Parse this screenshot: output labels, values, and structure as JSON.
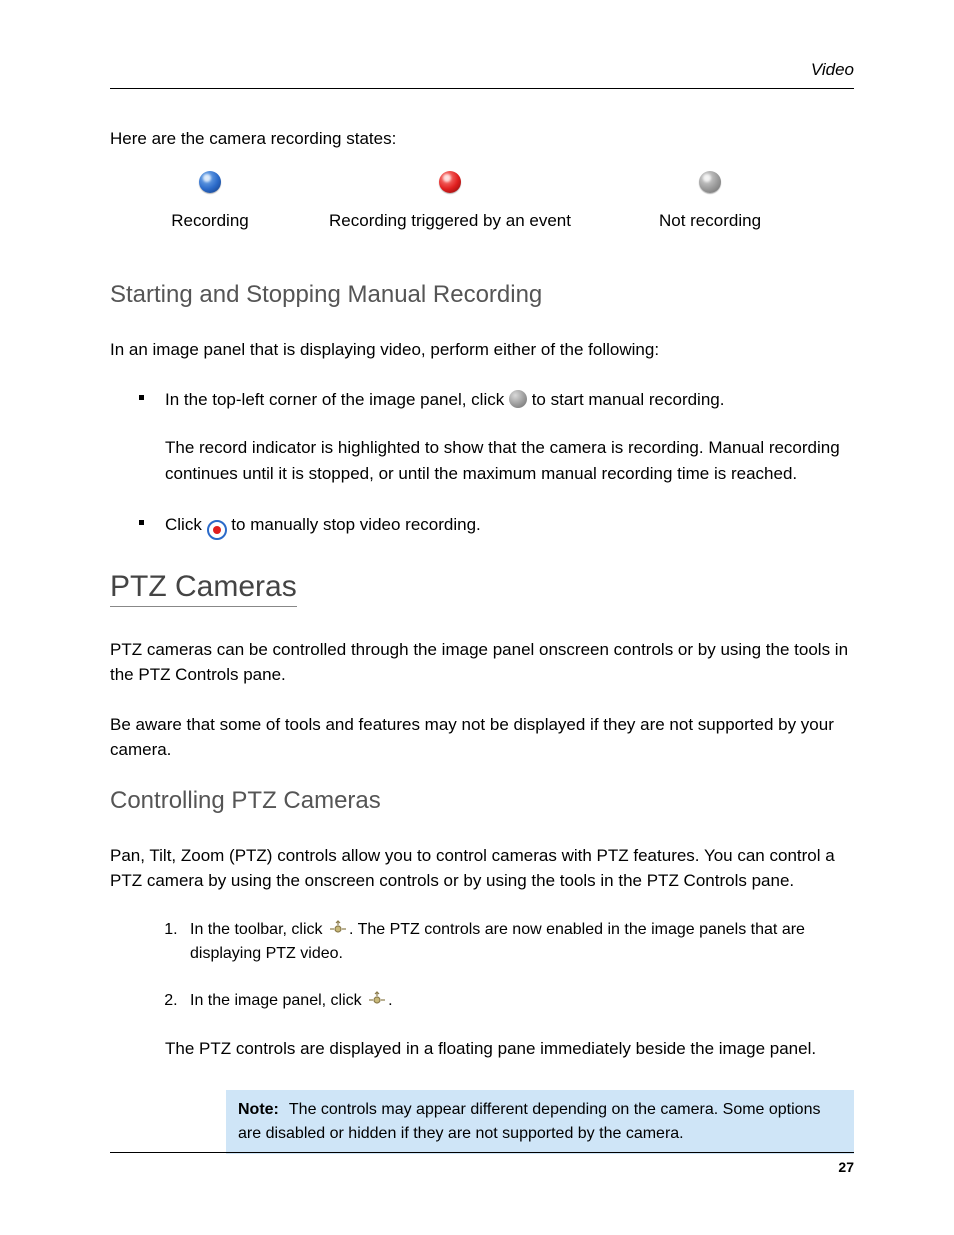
{
  "header": {
    "section_label": "Video"
  },
  "intro": "Here are the camera recording states:",
  "states": [
    {
      "label": "Recording"
    },
    {
      "label": "Recording triggered by an event"
    },
    {
      "label": "Not recording"
    }
  ],
  "subhead1": "Starting and Stopping Manual Recording",
  "para1": "In an image panel that is displaying video, perform either of the following:",
  "bullets": {
    "b1_pre": "In the top-left corner of the image panel, click ",
    "b1_post": " to start manual recording.",
    "b1_follow": "The record indicator is highlighted to show that the camera is recording. Manual recording continues until it is stopped, or until the maximum manual recording time is reached.",
    "b2_pre": "Click ",
    "b2_post": " to manually stop video recording."
  },
  "section2": "PTZ Cameras",
  "para2": "PTZ cameras can be controlled through the image panel onscreen controls or by using the tools in the PTZ Controls pane.",
  "para3": "Be aware that some of tools and features may not be displayed if they are not supported by your camera.",
  "subhead2": "Controlling PTZ Cameras",
  "para4": "Pan, Tilt, Zoom (PTZ) controls allow you to control cameras with PTZ features. You can control a PTZ camera by using the onscreen controls or by using the tools in the PTZ Controls pane.",
  "steps": {
    "s1_pre": "In the toolbar, click ",
    "s1_post": ". The PTZ controls are now enabled in the image panels that are displaying PTZ video.",
    "s2_pre": "In the image panel, click ",
    "s2_post": "."
  },
  "step_follow": "The PTZ controls are displayed in a floating pane immediately beside the image panel.",
  "note": {
    "label": "Note:",
    "text": "The controls may appear different depending on the camera. Some options are disabled or hidden if they are not supported by the camera."
  },
  "page_number": "27"
}
